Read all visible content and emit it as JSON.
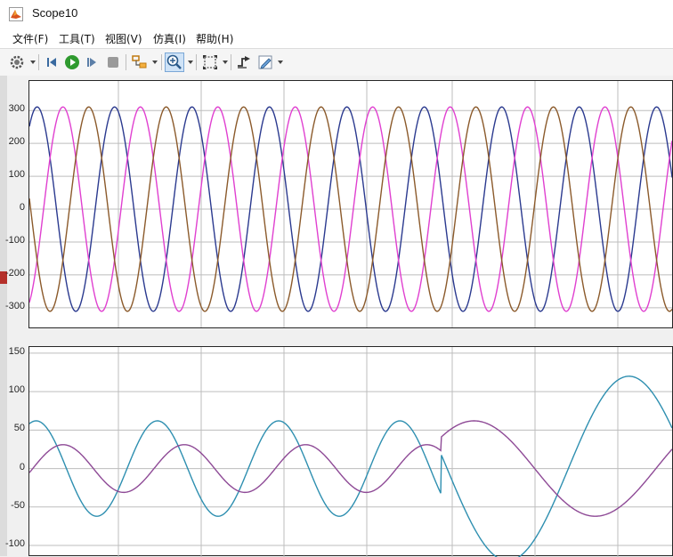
{
  "window": {
    "title": "Scope10"
  },
  "menu": {
    "items": [
      {
        "label": "文件(F)"
      },
      {
        "label": "工具(T)"
      },
      {
        "label": "视图(V)"
      },
      {
        "label": "仿真(I)"
      },
      {
        "label": "帮助(H)"
      }
    ]
  },
  "toolbar": {
    "buttons": [
      {
        "name": "settings-button",
        "icon": "gear-icon"
      },
      {
        "name": "step-back-button",
        "icon": "step-back-icon"
      },
      {
        "name": "run-button",
        "icon": "play-icon"
      },
      {
        "name": "step-forward-button",
        "icon": "step-forward-icon"
      },
      {
        "name": "stop-button",
        "icon": "stop-icon"
      },
      {
        "name": "highlight-button",
        "icon": "highlight-block-icon"
      },
      {
        "name": "zoom-button",
        "icon": "zoom-in-icon",
        "pressed": true
      },
      {
        "name": "autoscale-button",
        "icon": "autoscale-icon"
      },
      {
        "name": "triggers-button",
        "icon": "trigger-icon"
      },
      {
        "name": "style-button",
        "icon": "pencil-icon"
      }
    ]
  },
  "colors": {
    "grid": "#bdbdbd",
    "axes_border": "#262626",
    "phase_a": "#8b5a2b",
    "phase_b": "#e040d0",
    "phase_c": "#2b3a8f",
    "signal_1": "#2e8fb0",
    "signal_2": "#8e4a96"
  },
  "chart_data": [
    {
      "type": "line",
      "title": "",
      "xlabel": "",
      "ylabel": "",
      "yticks": [
        "300",
        "200",
        "100",
        "0",
        "-100",
        "-200",
        "-300"
      ],
      "ylim": [
        -360,
        390
      ],
      "grid": true,
      "series": [
        {
          "color": "#2b3a8f",
          "amplitude": 311,
          "cycles": 8.3,
          "phase_deg": 54
        },
        {
          "color": "#e040d0",
          "amplitude": 311,
          "cycles": 8.3,
          "phase_deg": -66
        },
        {
          "color": "#8b5a2b",
          "amplitude": 311,
          "cycles": 8.3,
          "phase_deg": 174
        }
      ]
    },
    {
      "type": "line",
      "title": "",
      "xlabel": "",
      "ylabel": "",
      "yticks": [
        "150",
        "100",
        "50",
        "0",
        "-50",
        "-100"
      ],
      "ylim": [
        -115,
        158
      ],
      "grid": true,
      "series": [
        {
          "color": "#2e8fb0",
          "segments": [
            {
              "x_end": 0.64,
              "amplitude": 62,
              "cycles_per_width": 5.3,
              "phase_deg": 70
            },
            {
              "x_end": 1.0,
              "amplitude": 120,
              "cycles_per_width": 2.65,
              "phase_deg": -80
            }
          ]
        },
        {
          "color": "#8e4a96",
          "segments": [
            {
              "x_end": 0.64,
              "amplitude": 31,
              "cycles_per_width": 5.3,
              "phase_deg": -10
            },
            {
              "x_end": 1.0,
              "amplitude": 62,
              "cycles_per_width": 2.65,
              "phase_deg": 150
            }
          ]
        }
      ]
    }
  ]
}
